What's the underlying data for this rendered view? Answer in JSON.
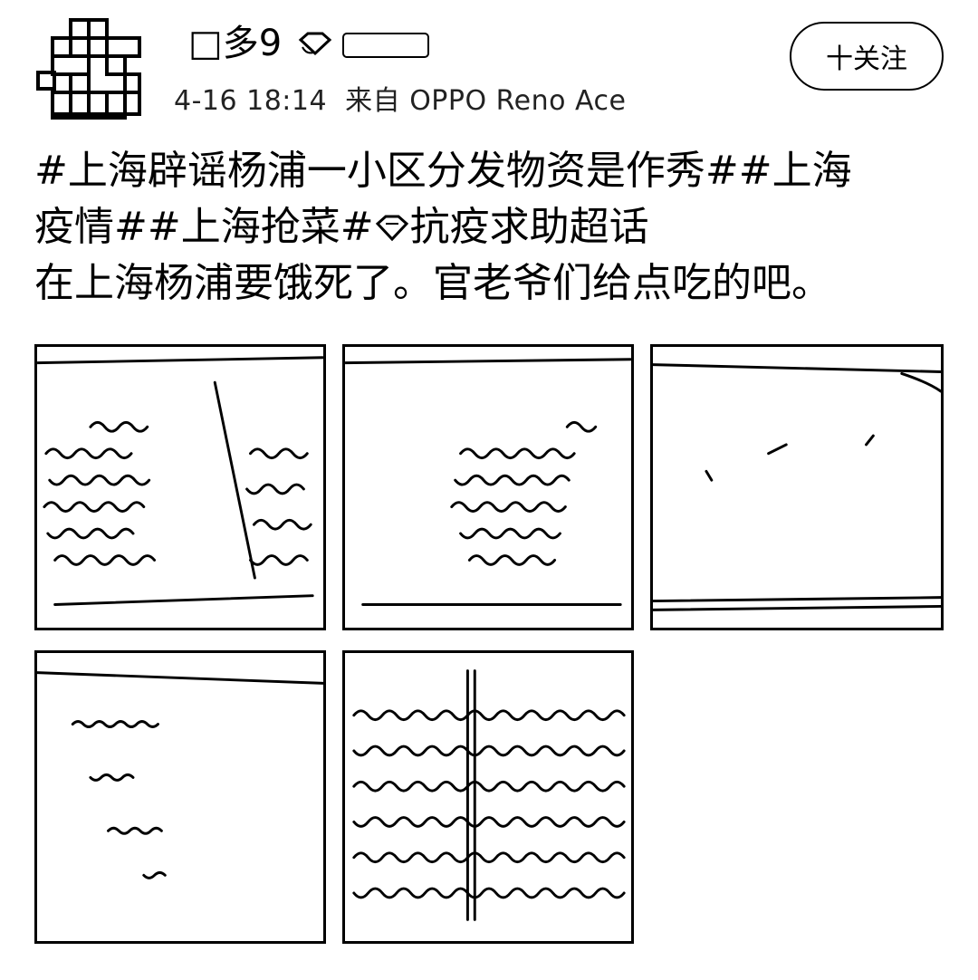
{
  "user": {
    "name": "□多9",
    "timestamp": "4-16 18:14",
    "source": "来自 OPPO Reno Ace"
  },
  "follow_button": {
    "label": "十关注"
  },
  "post": {
    "line1": "#上海辟谣杨浦一小区分发物资是作秀##上海",
    "line2_a": "疫情##上海抢菜#",
    "line2_b": "抗疫求助超话",
    "line3": "在上海杨浦要饿死了。官老爷们给点吃的吧。"
  },
  "images": [
    {
      "name": "photo-1",
      "description_icon": "food-bag-icon"
    },
    {
      "name": "photo-2",
      "description_icon": "food-bag-icon"
    },
    {
      "name": "photo-3",
      "description_icon": "empty-bag-icon"
    },
    {
      "name": "photo-4",
      "description_icon": "bag-icon"
    },
    {
      "name": "photo-5",
      "description_icon": "food-bag-icon"
    }
  ]
}
